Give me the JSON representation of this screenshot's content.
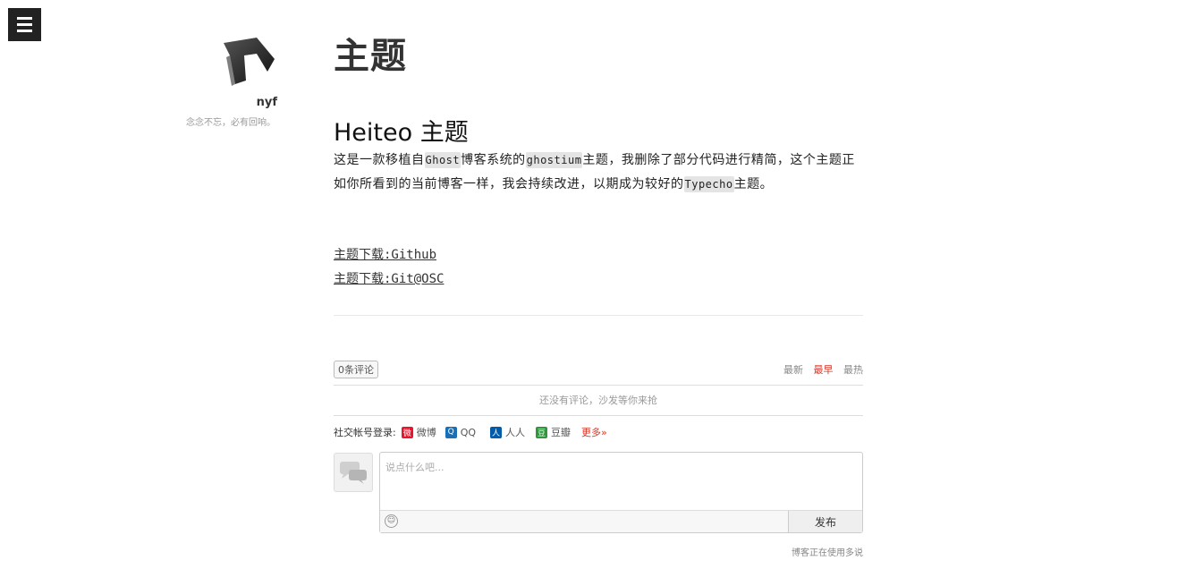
{
  "author": {
    "name": "nyf",
    "motto": "念念不忘，必有回响。"
  },
  "page": {
    "title": "主题"
  },
  "post": {
    "title": "Heiteo 主题",
    "body": {
      "t1": "这是一款移植自",
      "c1": "Ghost",
      "t2": "博客系统的",
      "c2": "ghostium",
      "t3": "主题，我删除了部分代码进行精简，这个主题正如你所看到的当前博客一样，我会持续改进，以期成为较好的",
      "c3": "Typecho",
      "t4": "主题。"
    },
    "links": [
      {
        "label": "主题下载:Github"
      },
      {
        "label": "主题下载:Git@OSC"
      }
    ]
  },
  "comments": {
    "count_label": "0条评论",
    "sort": {
      "latest": "最新",
      "earliest": "最早",
      "hottest": "最热",
      "active": "earliest"
    },
    "empty_message": "还没有评论，沙发等你来抢",
    "social_login_label": "社交帐号登录:",
    "social": [
      {
        "label": "微博",
        "icon": "weibo-icon",
        "color": "#e6162d"
      },
      {
        "label": "QQ",
        "icon": "qq-icon",
        "color": "#1a6fb5"
      },
      {
        "label": "人人",
        "icon": "renren-icon",
        "color": "#005baa"
      },
      {
        "label": "豆瓣",
        "icon": "douban-icon",
        "color": "#2e963d"
      }
    ],
    "more_label": "更多»",
    "input_placeholder": "说点什么吧...",
    "submit_label": "发布",
    "powered_by": "博客正在使用多说"
  },
  "colors": {
    "accent": "#dd3322",
    "menu_bg": "#222222"
  }
}
